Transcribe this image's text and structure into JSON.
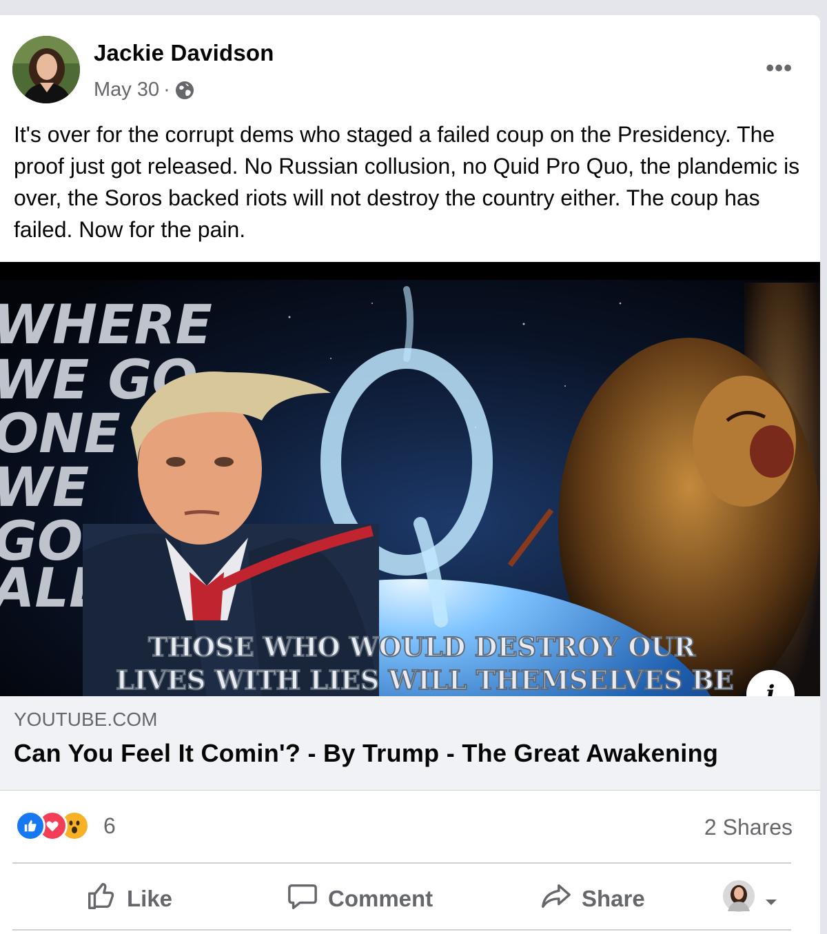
{
  "post": {
    "author": "Jackie Davidson",
    "date": "May 30",
    "separator": "·",
    "audience_icon": "globe-icon",
    "more_label": "•••",
    "text": "It's over for the corrupt dems who staged a failed coup on the Presidency. The proof just got released. No Russian collusion, no Quid Pro Quo, the plandemic is over, the Soros backed riots will not destroy the country either. The coup has failed. Now for the pain."
  },
  "link_preview": {
    "image_overlay_left": [
      "WHERE",
      "WE GO",
      "ONE",
      "WE",
      "GO",
      "ALL"
    ],
    "image_overlay_caption_line1": "THOSE WHO WOULD DESTROY OUR",
    "image_overlay_caption_line2": "LIVES WITH LIES WILL THEMSELVES BE",
    "info_label": "i",
    "domain": "YOUTUBE.COM",
    "title": "Can You Feel It Comin'? - By Trump - The Great Awakening"
  },
  "stats": {
    "reaction_icons": [
      "like-icon",
      "love-icon",
      "wow-icon"
    ],
    "reaction_count": "6",
    "shares": "2 Shares"
  },
  "actions": {
    "like": "Like",
    "comment": "Comment",
    "share": "Share"
  },
  "colors": {
    "like_blue": "#1877f2",
    "love_red": "#f33e58",
    "wow_yellow": "#f7b125",
    "secondary_text": "#65676b"
  }
}
